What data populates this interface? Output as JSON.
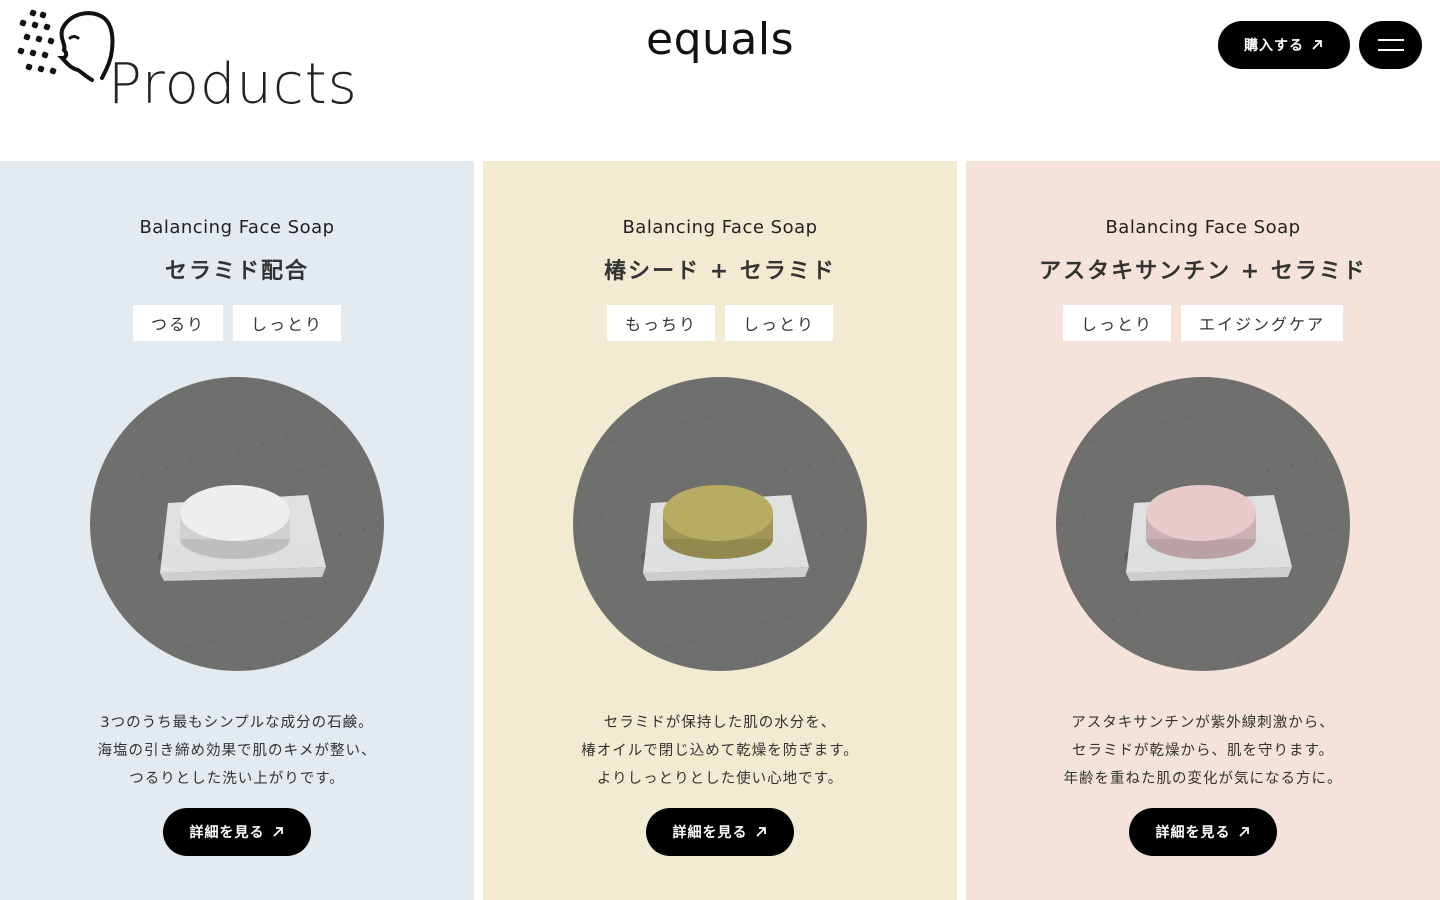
{
  "header": {
    "page_title": "Products",
    "brand": "equals",
    "buy_label": "購入する",
    "logo_icon": "face-dots-icon",
    "menu_icon": "hamburger-menu-icon"
  },
  "products": [
    {
      "eyebrow": "Balancing Face Soap",
      "name": "セラミド配合",
      "tags": [
        "つるり",
        "しっとり"
      ],
      "description": [
        "3つのうち最もシンプルな成分の石鹸。",
        "海塩の引き締め効果で肌のキメが整い、",
        "つるりとした洗い上がりです。"
      ],
      "cta": "詳細を見る",
      "bg_color": "#e3eaf0",
      "soap_color": "#efedee"
    },
    {
      "eyebrow": "Balancing Face Soap",
      "name": "椿シード + セラミド",
      "tags": [
        "もっちり",
        "しっとり"
      ],
      "description": [
        "セラミドが保持した肌の水分を、",
        "椿オイルで閉じ込めて乾燥を防ぎます。",
        "よりしっとりとした使い心地です。"
      ],
      "cta": "詳細を見る",
      "bg_color": "#f3ead2",
      "soap_color": "#b8ab62"
    },
    {
      "eyebrow": "Balancing Face Soap",
      "name": "アスタキサンチン + セラミド",
      "tags": [
        "しっとり",
        "エイジングケア"
      ],
      "description": [
        "アスタキサンチンが紫外線刺激から、",
        "セラミドが乾燥から、肌を守ります。",
        "年齢を重ねた肌の変化が気になる方に。"
      ],
      "cta": "詳細を見る",
      "bg_color": "#f5e3db",
      "soap_color": "#e8c9cc"
    }
  ],
  "colors": {
    "button_bg": "#000000",
    "button_text": "#ffffff",
    "photo_bg": "#6f6f6d"
  }
}
